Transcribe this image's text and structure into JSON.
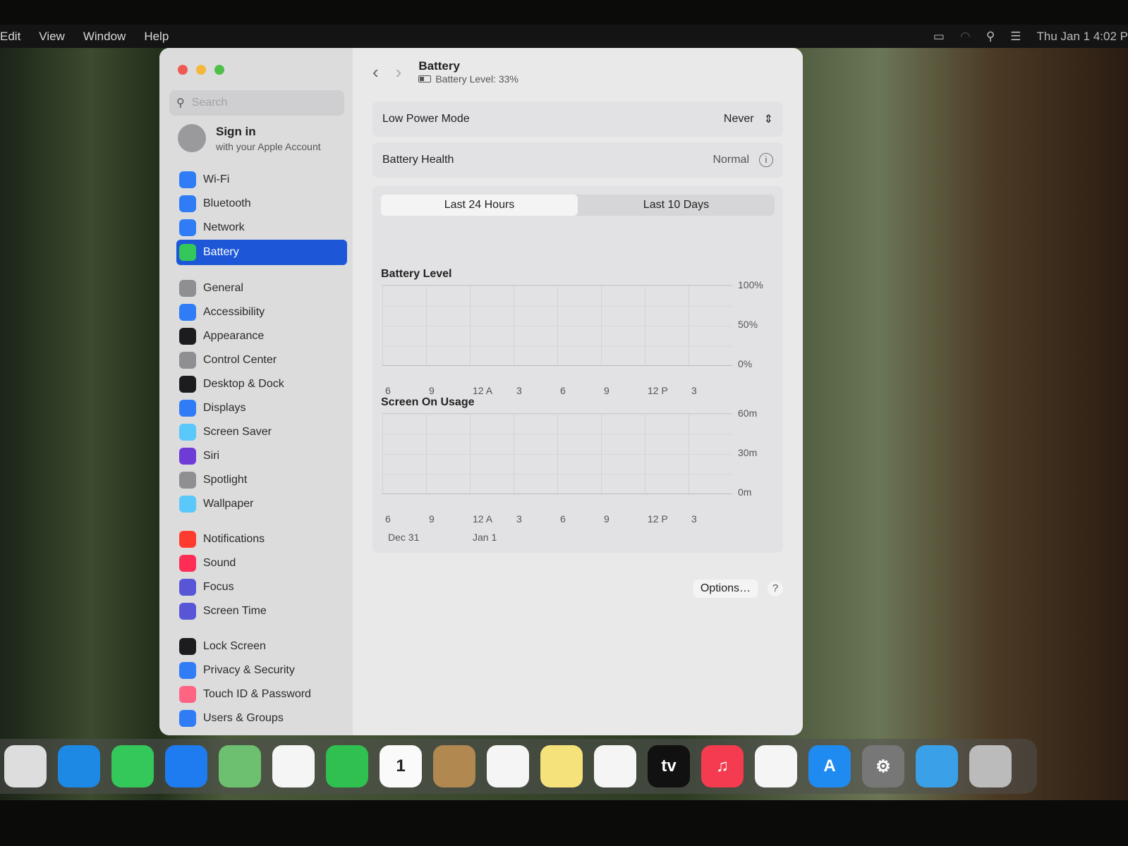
{
  "menubar": {
    "items": [
      "Edit",
      "View",
      "Window",
      "Help"
    ],
    "clock": "Thu Jan 1  4:02 P"
  },
  "sidebar": {
    "search_placeholder": "Search",
    "account": {
      "title": "Sign in",
      "subtitle": "with your Apple Account"
    },
    "groups": [
      [
        {
          "label": "Wi-Fi",
          "icon": "wifi-icon",
          "color": "#2f7cf6"
        },
        {
          "label": "Bluetooth",
          "icon": "bluetooth-icon",
          "color": "#2f7cf6"
        },
        {
          "label": "Network",
          "icon": "globe-icon",
          "color": "#2f7cf6"
        },
        {
          "label": "Battery",
          "icon": "battery-icon",
          "color": "#34c759",
          "selected": true
        }
      ],
      [
        {
          "label": "General",
          "icon": "gear-icon",
          "color": "#8e8e93"
        },
        {
          "label": "Accessibility",
          "icon": "accessibility-icon",
          "color": "#2f7cf6"
        },
        {
          "label": "Appearance",
          "icon": "appearance-icon",
          "color": "#1c1c1e"
        },
        {
          "label": "Control Center",
          "icon": "control-center-icon",
          "color": "#8e8e93"
        },
        {
          "label": "Desktop & Dock",
          "icon": "dock-icon",
          "color": "#1c1c1e"
        },
        {
          "label": "Displays",
          "icon": "sun-icon",
          "color": "#2f7cf6"
        },
        {
          "label": "Screen Saver",
          "icon": "screen-saver-icon",
          "color": "#5ac8fa"
        },
        {
          "label": "Siri",
          "icon": "siri-icon",
          "color": "#6e3bd6"
        },
        {
          "label": "Spotlight",
          "icon": "search-icon",
          "color": "#8e8e93"
        },
        {
          "label": "Wallpaper",
          "icon": "wallpaper-icon",
          "color": "#5ac8fa"
        }
      ],
      [
        {
          "label": "Notifications",
          "icon": "bell-icon",
          "color": "#ff3b30"
        },
        {
          "label": "Sound",
          "icon": "speaker-icon",
          "color": "#ff2d55"
        },
        {
          "label": "Focus",
          "icon": "moon-icon",
          "color": "#5856d6"
        },
        {
          "label": "Screen Time",
          "icon": "hourglass-icon",
          "color": "#5856d6"
        }
      ],
      [
        {
          "label": "Lock Screen",
          "icon": "lock-icon",
          "color": "#1c1c1e"
        },
        {
          "label": "Privacy & Security",
          "icon": "hand-icon",
          "color": "#2f7cf6"
        },
        {
          "label": "Touch ID & Password",
          "icon": "fingerprint-icon",
          "color": "#ff6482"
        },
        {
          "label": "Users & Groups",
          "icon": "users-icon",
          "color": "#2f7cf6"
        }
      ]
    ]
  },
  "header": {
    "title": "Battery",
    "subtitle": "Battery Level: 33%",
    "battery_level": 0.33
  },
  "low_power": {
    "label": "Low Power Mode",
    "value": "Never"
  },
  "health": {
    "label": "Battery Health",
    "value": "Normal"
  },
  "tabs": [
    "Last 24 Hours",
    "Last 10 Days"
  ],
  "chart_data": [
    {
      "type": "bar",
      "title": "Battery Level",
      "y_ticks": [
        "100%",
        "50%",
        "0%"
      ],
      "x_ticks": [
        "6",
        "9",
        "12 A",
        "3",
        "6",
        "9",
        "12 P",
        "3"
      ],
      "values": []
    },
    {
      "type": "bar",
      "title": "Screen On Usage",
      "y_ticks": [
        "60m",
        "30m",
        "0m"
      ],
      "x_ticks": [
        "6",
        "9",
        "12 A",
        "3",
        "6",
        "9",
        "12 P",
        "3"
      ],
      "date_labels": [
        "Dec 31",
        "Jan 1"
      ],
      "values": []
    }
  ],
  "options_label": "Options…",
  "help_label": "?",
  "dock": [
    {
      "name": "launchpad",
      "color": "#ddd"
    },
    {
      "name": "safari",
      "color": "#1e88e5"
    },
    {
      "name": "messages",
      "color": "#34c759"
    },
    {
      "name": "mail",
      "color": "#1e7cf0"
    },
    {
      "name": "maps",
      "color": "#6cc070"
    },
    {
      "name": "photos",
      "color": "#f5f5f5"
    },
    {
      "name": "facetime",
      "color": "#30c04f"
    },
    {
      "name": "calendar",
      "color": "#fafafa",
      "text": "1"
    },
    {
      "name": "contacts",
      "color": "#b08850"
    },
    {
      "name": "reminders",
      "color": "#f5f5f5"
    },
    {
      "name": "notes",
      "color": "#f6e27a"
    },
    {
      "name": "freeform",
      "color": "#f5f5f5"
    },
    {
      "name": "tv",
      "color": "#111",
      "text": "tv"
    },
    {
      "name": "music",
      "color": "#f43b4f",
      "text": "♫"
    },
    {
      "name": "news",
      "color": "#f5f5f5"
    },
    {
      "name": "app-store",
      "color": "#1f8af0",
      "text": "A"
    },
    {
      "name": "system-settings",
      "color": "#777",
      "text": "⚙"
    },
    {
      "name": "downloads",
      "color": "#3aa0e8"
    },
    {
      "name": "trash",
      "color": "#bbb"
    }
  ]
}
